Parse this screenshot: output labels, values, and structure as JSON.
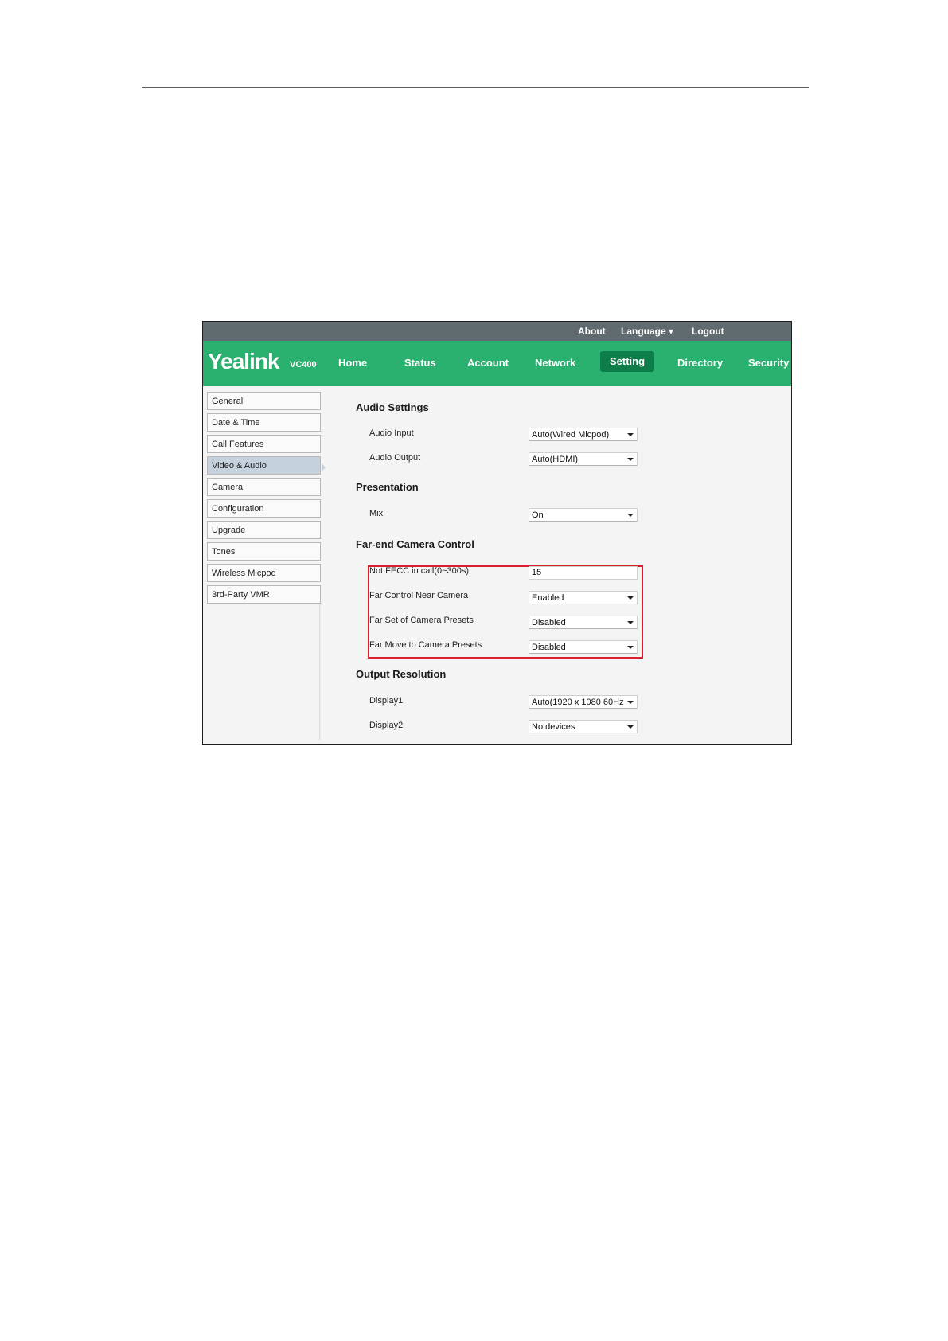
{
  "topbar": {
    "about": "About",
    "language": "Language ▾",
    "logout": "Logout"
  },
  "brand": {
    "logo": "Yealink",
    "model": "VC400"
  },
  "nav": {
    "tabs": [
      "Home",
      "Status",
      "Account",
      "Network",
      "Setting",
      "Directory",
      "Security"
    ],
    "active": "Setting"
  },
  "sidebar": {
    "items": [
      "General",
      "Date & Time",
      "Call Features",
      "Video & Audio",
      "Camera",
      "Configuration",
      "Upgrade",
      "Tones",
      "Wireless Micpod",
      "3rd-Party VMR"
    ],
    "active": "Video & Audio"
  },
  "sections": {
    "audio": {
      "title": "Audio Settings",
      "audio_input_label": "Audio Input",
      "audio_input_value": "Auto(Wired Micpod)",
      "audio_output_label": "Audio Output",
      "audio_output_value": "Auto(HDMI)"
    },
    "presentation": {
      "title": "Presentation",
      "mix_label": "Mix",
      "mix_value": "On"
    },
    "fecc": {
      "title": "Far-end Camera Control",
      "not_fecc_label": "Not FECC in call(0~300s)",
      "not_fecc_value": "15",
      "far_control_label": "Far Control Near Camera",
      "far_control_value": "Enabled",
      "far_set_label": "Far Set of Camera Presets",
      "far_set_value": "Disabled",
      "far_move_label": "Far Move to Camera Presets",
      "far_move_value": "Disabled"
    },
    "output": {
      "title": "Output Resolution",
      "display1_label": "Display1",
      "display1_value": "Auto(1920 x 1080 60Hz",
      "display2_label": "Display2",
      "display2_value": "No devices"
    }
  },
  "colors": {
    "nav_green": "#2ab16f",
    "active_tab": "#0d7d4a",
    "topbar": "#606b70",
    "highlight": "#d9202a"
  }
}
